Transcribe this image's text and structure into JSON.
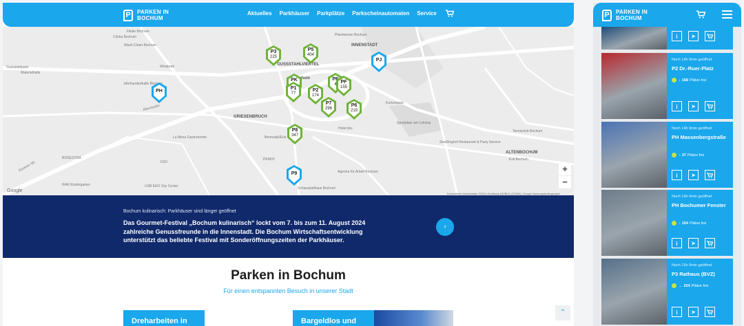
{
  "brand": {
    "line1": "PARKEN IN",
    "line2": "BOCHUM",
    "logo_letter": "P"
  },
  "nav": [
    "Aktuelles",
    "Parkhäuser",
    "Parkplätze",
    "Parkscheinautomaten",
    "Service"
  ],
  "icons": {
    "cart": "cart-icon",
    "menu": "hamburger-icon",
    "info": "info-icon",
    "navigate": "navigation-arrow-icon",
    "buy": "cart-icon"
  },
  "map": {
    "labels": [
      "Filiale Bochum",
      "Ciloha Bochum",
      "Wash Clean Bochum",
      "Westpark",
      "Jahrhunderthalle Bochum",
      "Gussstahlpark",
      "Materialhalle",
      "GRIESENBRUCH",
      "INNENSTADT",
      "GUSSSTAHLVIERTEL",
      "Planetarium Bochum",
      "Kortumpark",
      "Sportplatz am Lohring",
      "Tennisclub Bochum",
      "ALTENBOCHUM",
      "Straßlinghof Restaurant & Party Service",
      "La Mesa Gastronomie",
      "BOGESTRA",
      "Schauspielhaus Bochum",
      "USB EKO City Center",
      "IFAK Kindergarten",
      "Bermuda3Eck",
      "Bochum",
      "Evli Bochum",
      "Hotel ibis",
      "Agentur für Arbeit Bochum",
      "DSV",
      "PENNY",
      "Essener Str.",
      "Alleestraße"
    ],
    "markers": [
      {
        "code": "P3",
        "count": "225",
        "kind": "green"
      },
      {
        "code": "P5",
        "count": "404",
        "kind": "green"
      },
      {
        "code": "PJ",
        "count": "",
        "kind": "blue"
      },
      {
        "code": "PH",
        "count": "",
        "kind": "blue"
      },
      {
        "code": "PK",
        "count": "",
        "kind": "green"
      },
      {
        "code": "P1",
        "count": "77",
        "kind": "green"
      },
      {
        "code": "P2",
        "count": "174",
        "kind": "green"
      },
      {
        "code": "PE",
        "count": "4",
        "kind": "green"
      },
      {
        "code": "PF",
        "count": "155",
        "kind": "green"
      },
      {
        "code": "P7",
        "count": "296",
        "kind": "green"
      },
      {
        "code": "P6",
        "count": "219",
        "kind": "green"
      },
      {
        "code": "P8",
        "count": "347",
        "kind": "green"
      },
      {
        "code": "P9",
        "count": "",
        "kind": "blue"
      }
    ],
    "zoom_in": "+",
    "zoom_out": "−",
    "google": "Google",
    "footer": "Kurzbefehle   Kartendaten ©2024 GeoBasis-DE/BKG (©2009), Google   Nutzungsbedingungen"
  },
  "banner": {
    "small": "Bochum kulinarisch: Parkhäuser sind länger geöffnet",
    "body": "Das Gourmet-Festival „Bochum kulinarisch“ lockt vom 7. bis zum 11. August 2024 zahlreiche Genussfreunde in die Innenstadt. Die Bochum Wirtschaftsentwicklung unterstützt das beliebte Festival mit Sonderöffnungszeiten der Parkhäuser.",
    "next": "›"
  },
  "section": {
    "title": "Parken in Bochum",
    "subtitle": "Für einen entspannten Besuch in unserer Stadt"
  },
  "cards": [
    "Dreharbeiten in",
    "Bargeldlos und"
  ],
  "scroll_top": "⌃",
  "mobile_items": [
    {
      "open": "",
      "name": "",
      "arrow": "",
      "free": "",
      "color": "#1f4d7a"
    },
    {
      "open": "Noch 14h 9min geöffnet",
      "name": "P2 Dr.-Ruer-Platz",
      "arrow": "↓",
      "free_num": "168",
      "free": "Plätze frei",
      "color": "#b8292e"
    },
    {
      "open": "Noch 14h 9min geöffnet",
      "name": "PH Massenbergstraße",
      "arrow": "↑",
      "free_num": "37",
      "free": "Plätze frei",
      "color": "#4a73b5"
    },
    {
      "open": "Noch 14h 9min geöffnet",
      "name": "PH Bochumer Fenster",
      "arrow": "↓",
      "free_num": "154",
      "free": "Plätze frei",
      "color": "#6d7c8a"
    },
    {
      "open": "Noch 13h 9min geöffnet",
      "name": "P3 Rathaus (BVZ)",
      "arrow": "→",
      "free_num": "224",
      "free": "Plätze frei",
      "color": "#55708a"
    }
  ],
  "btn_labels": {
    "info": "i",
    "nav": "➤",
    "cart": "🛒"
  }
}
